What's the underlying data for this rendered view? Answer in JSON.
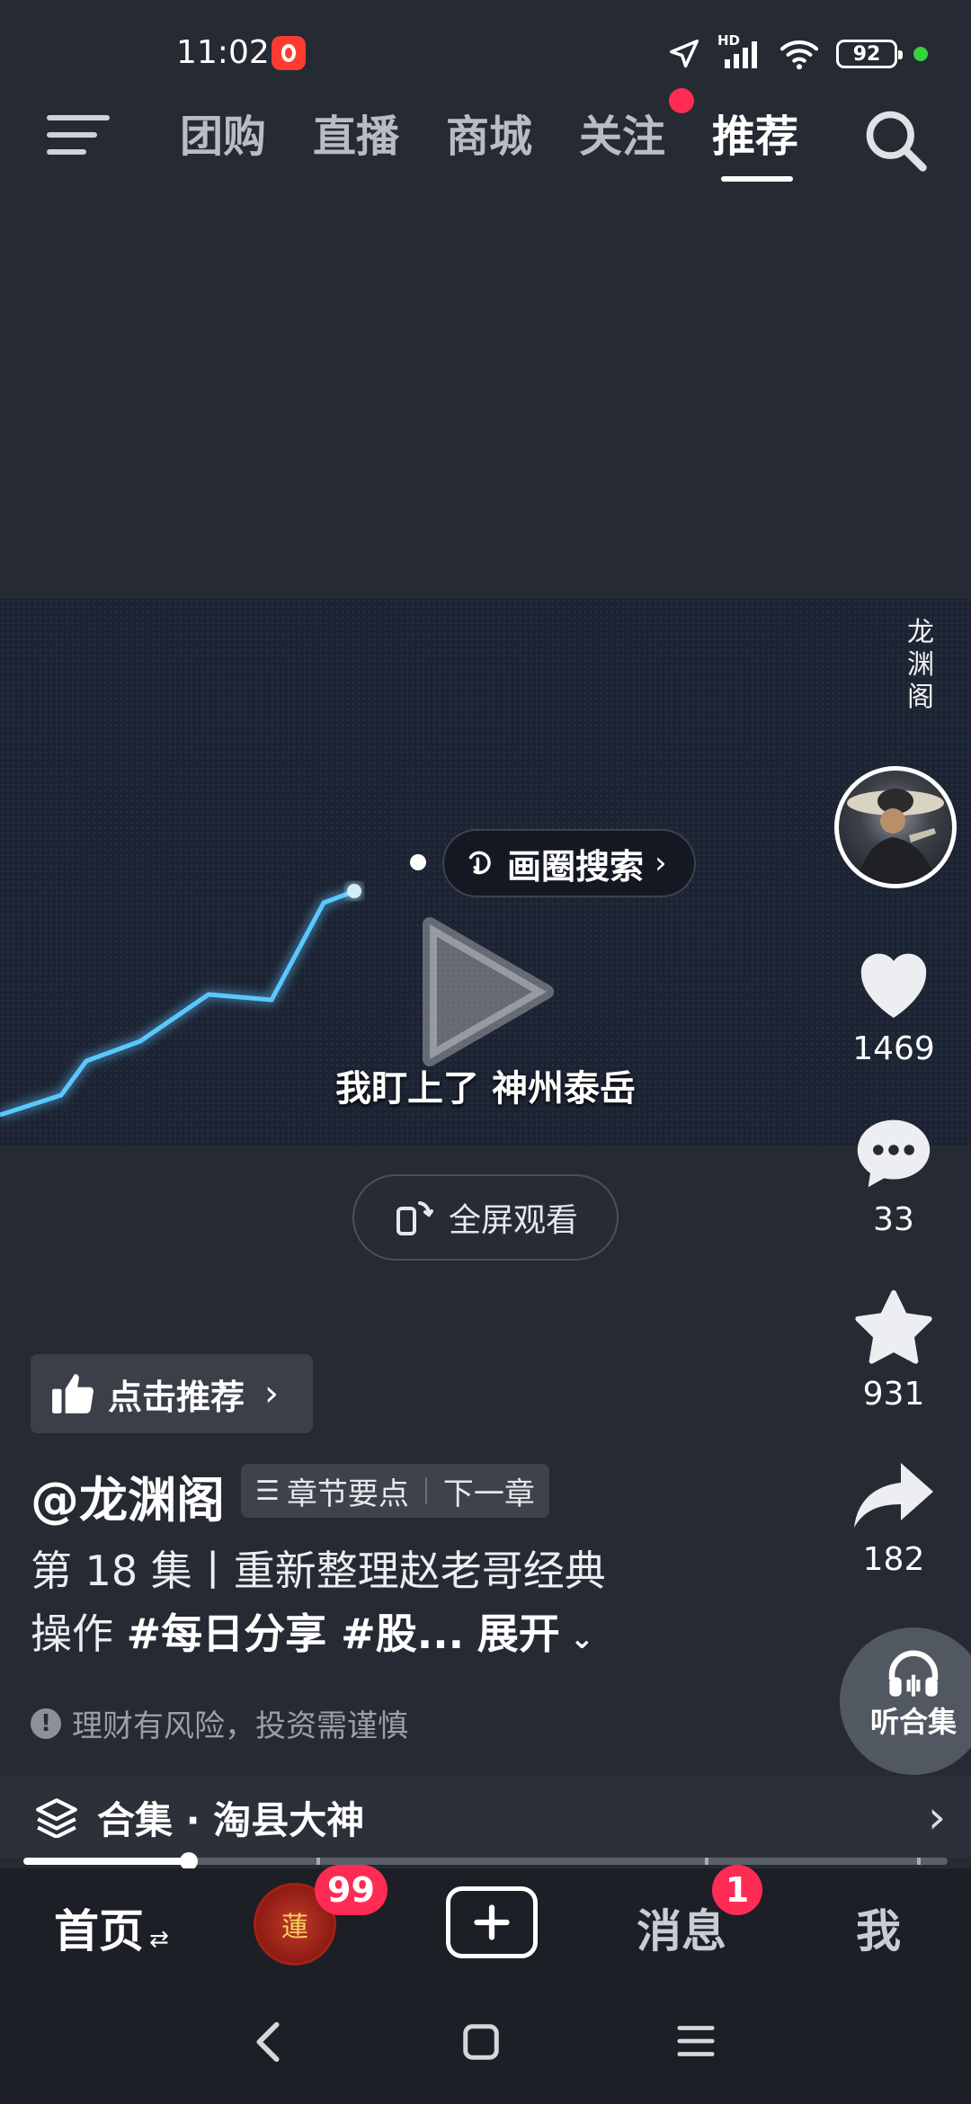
{
  "status_bar": {
    "time": "11:02",
    "network": "HD",
    "battery": "92"
  },
  "top_nav": {
    "tabs": [
      {
        "label": "团购"
      },
      {
        "label": "直播"
      },
      {
        "label": "商城"
      },
      {
        "label": "关注"
      },
      {
        "label": "推荐"
      }
    ],
    "active_tab": "推荐"
  },
  "video": {
    "watermark": "龙渊阁",
    "circle_search_label": "画圈搜索",
    "subtitle": "我盯上了 神州泰岳",
    "fullscreen_label": "全屏观看"
  },
  "actions": {
    "like_count": "1469",
    "comment_count": "33",
    "favorite_count": "931",
    "share_count": "182",
    "listen_label": "听合集"
  },
  "info": {
    "recommend_label": "点击推荐",
    "author": "@龙渊阁",
    "chapter_points": "章节要点",
    "next_chapter": "下一章",
    "desc_line1": "第 18 集丨重新整理赵老哥经典",
    "desc_line2_prefix": "操作 ",
    "desc_hashtags": "#每日分享 #股...",
    "expand_label": "展开",
    "risk_notice": "理财有风险，投资需谨慎",
    "collection_label": "合集 · 淘县大神"
  },
  "tabbar": {
    "home": "首页",
    "home_badge": "99",
    "messages": "消息",
    "messages_badge": "1",
    "me": "我"
  },
  "colors": {
    "accent": "#fe2c55",
    "background": "#252a33",
    "line": "#4fc3ff"
  }
}
